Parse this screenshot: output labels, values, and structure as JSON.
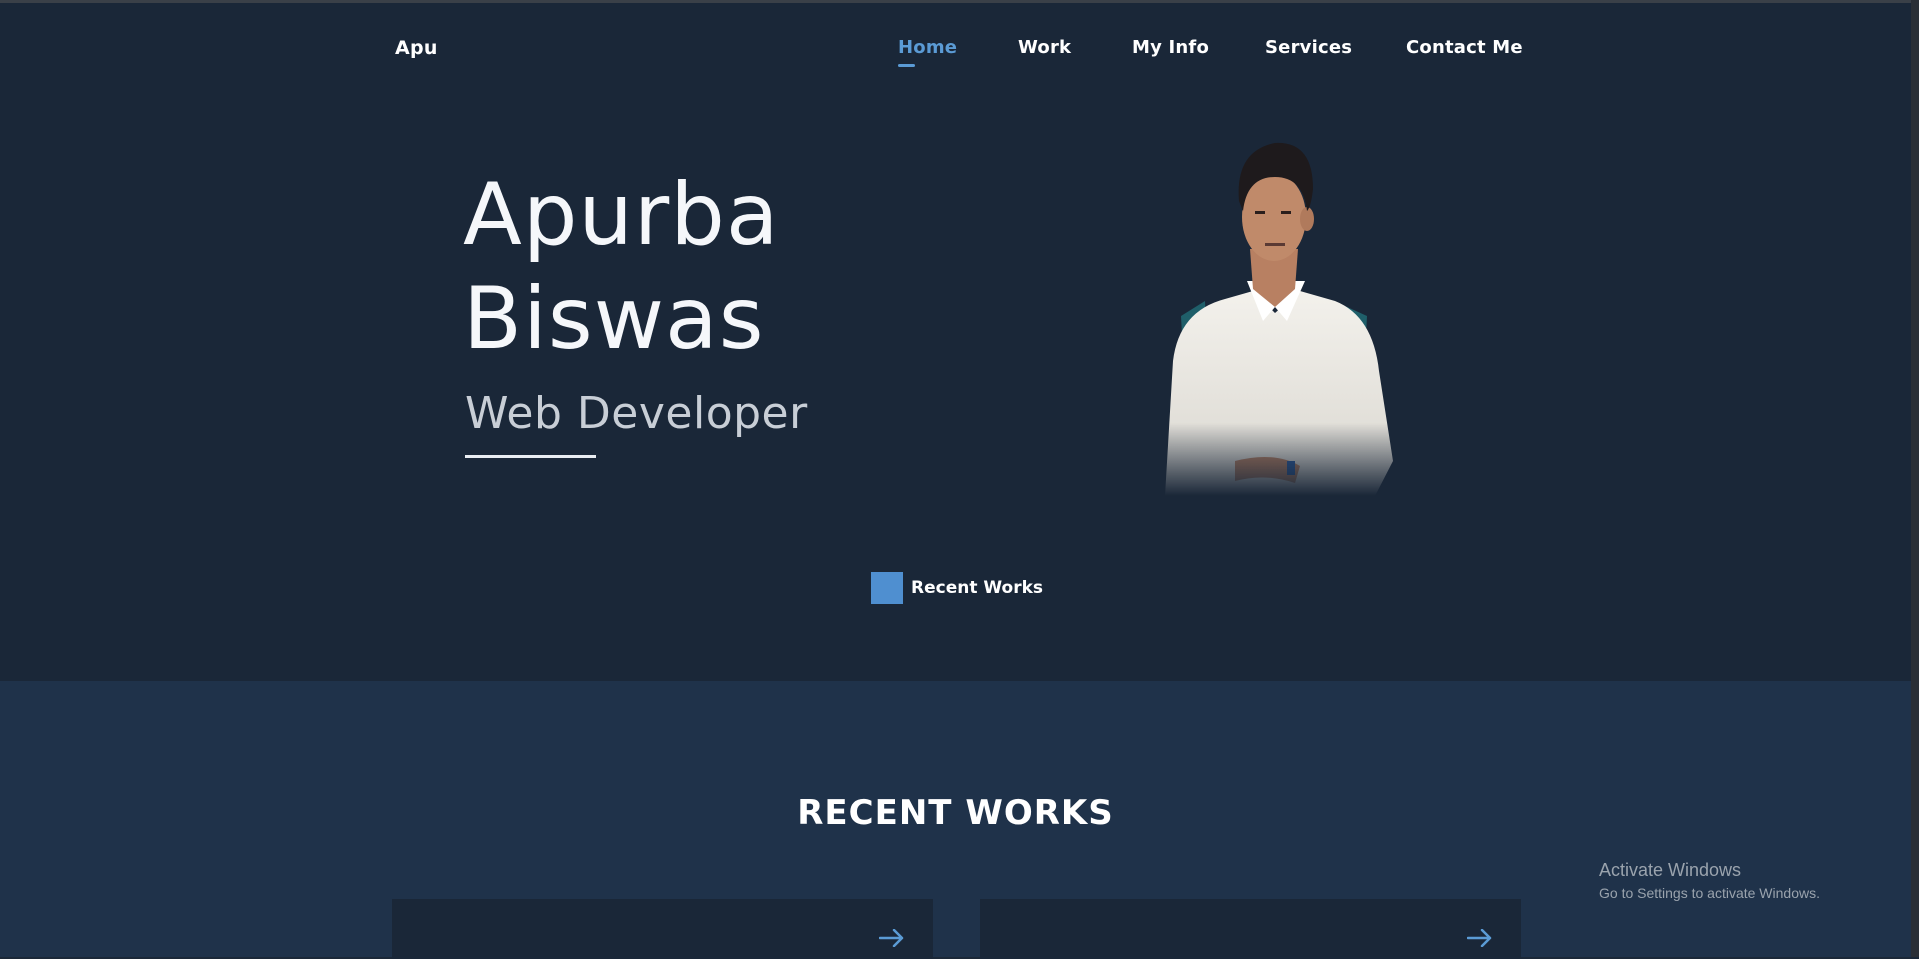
{
  "header": {
    "logo": "Apu",
    "nav": [
      {
        "label": "Home",
        "active": true
      },
      {
        "label": "Work",
        "active": false
      },
      {
        "label": "My Info",
        "active": false
      },
      {
        "label": "Services",
        "active": false
      },
      {
        "label": "Contact Me",
        "active": false
      }
    ]
  },
  "hero": {
    "first_name": "Apurba",
    "last_name": "Biswas",
    "role": "Web Developer",
    "cta_label": "Recent Works"
  },
  "recent_works": {
    "title": "RECENT WORKS",
    "cards": [
      {
        "icon": "arrow-right-icon"
      },
      {
        "icon": "arrow-right-icon"
      }
    ]
  },
  "os_watermark": {
    "line1": "Activate Windows",
    "line2": "Go to Settings to activate Windows."
  },
  "colors": {
    "accent": "#5b9bd5",
    "hero_bg": "#1a2738",
    "section_bg": "#1f324a",
    "card_bg": "#1a2738"
  }
}
